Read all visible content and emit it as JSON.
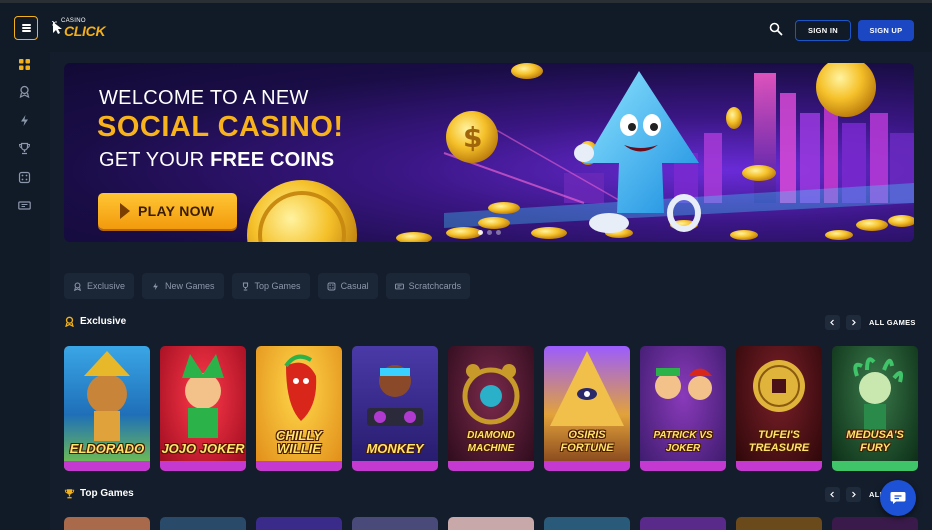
{
  "header": {
    "logo_small": "CASINO",
    "logo_big": "CLICK",
    "signin_label": "SIGN IN",
    "signup_label": "SIGN UP",
    "menu_icon": "hamburger-icon",
    "search_icon": "search-icon"
  },
  "sidebar": {
    "items": [
      {
        "icon": "grid-icon"
      },
      {
        "icon": "exclusive-icon"
      },
      {
        "icon": "lightning-icon"
      },
      {
        "icon": "trophy-icon"
      },
      {
        "icon": "dice-icon"
      },
      {
        "icon": "ticket-icon"
      }
    ]
  },
  "hero": {
    "line1": "WELCOME TO A NEW",
    "line2": "SOCIAL CASINO!",
    "line3_prefix": "GET YOUR ",
    "line3_bold": "FREE COINS",
    "cta_label": "PLAY NOW"
  },
  "filters": [
    {
      "label": "Exclusive",
      "icon": "exclusive-icon"
    },
    {
      "label": "New Games",
      "icon": "lightning-icon"
    },
    {
      "label": "Top Games",
      "icon": "trophy-icon"
    },
    {
      "label": "Casual",
      "icon": "dice-icon"
    },
    {
      "label": "Scratchcards",
      "icon": "ticket-icon"
    }
  ],
  "sections": {
    "exclusive": {
      "title": "Exclusive",
      "all_label": "ALL GAMES"
    },
    "top_games": {
      "title": "Top Games",
      "all_label": "ALL"
    }
  },
  "games": [
    {
      "name": "ELDORADO",
      "bg": "#2a8fd4",
      "accent": "#7ac943"
    },
    {
      "name": "JOJO JOKER",
      "bg": "#c8102e",
      "accent": "#2bb34a"
    },
    {
      "name": "CHILLY WILLIE",
      "bg": "#e8a317",
      "accent": "#3fa34d"
    },
    {
      "name": "MONKEY",
      "bg": "#3a2a8a",
      "accent": "#b03acf"
    },
    {
      "name": "DIAMOND MACHINE",
      "bg": "#4a1436",
      "accent": "#c79a2a"
    },
    {
      "name": "OSIRIS FORTUNE",
      "bg": "#e2a23a",
      "accent": "#9b5cff"
    },
    {
      "name": "PATRICK VS JOKER",
      "bg": "#6a2a9a",
      "accent": "#2bb34a"
    },
    {
      "name": "TUFEI'S TREASURE",
      "bg": "#4a1018",
      "accent": "#e0b43a"
    },
    {
      "name": "MEDUSA'S FURY",
      "bg": "#1f4a2a",
      "accent": "#3fc46a"
    }
  ],
  "colors": {
    "accent": "#f7b21c",
    "primary": "#1b47c2",
    "background": "#141d2b"
  }
}
